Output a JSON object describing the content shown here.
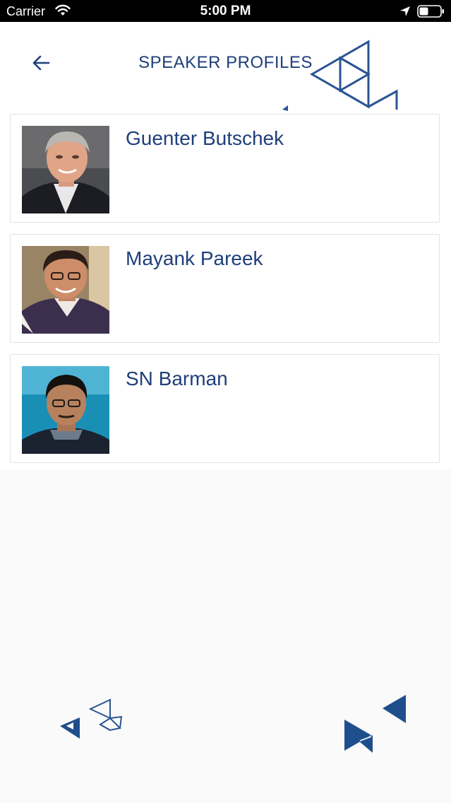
{
  "status_bar": {
    "carrier": "Carrier",
    "time": "5:00 PM",
    "icons": [
      "wifi-icon",
      "location-icon",
      "battery-icon"
    ]
  },
  "header": {
    "title": "SPEAKER PROFILES",
    "back_icon": "arrow-left-icon"
  },
  "speakers": [
    {
      "name": "Guenter Butschek",
      "photo": "speaker-photo"
    },
    {
      "name": "Mayank Pareek",
      "photo": "speaker-photo"
    },
    {
      "name": "SN Barman",
      "photo": "speaker-photo"
    }
  ],
  "colors": {
    "primary": "#1f3f7a",
    "accent_triangles": "#1f4e8c",
    "card_border": "#e2e2e2",
    "background": "#fafafa"
  }
}
